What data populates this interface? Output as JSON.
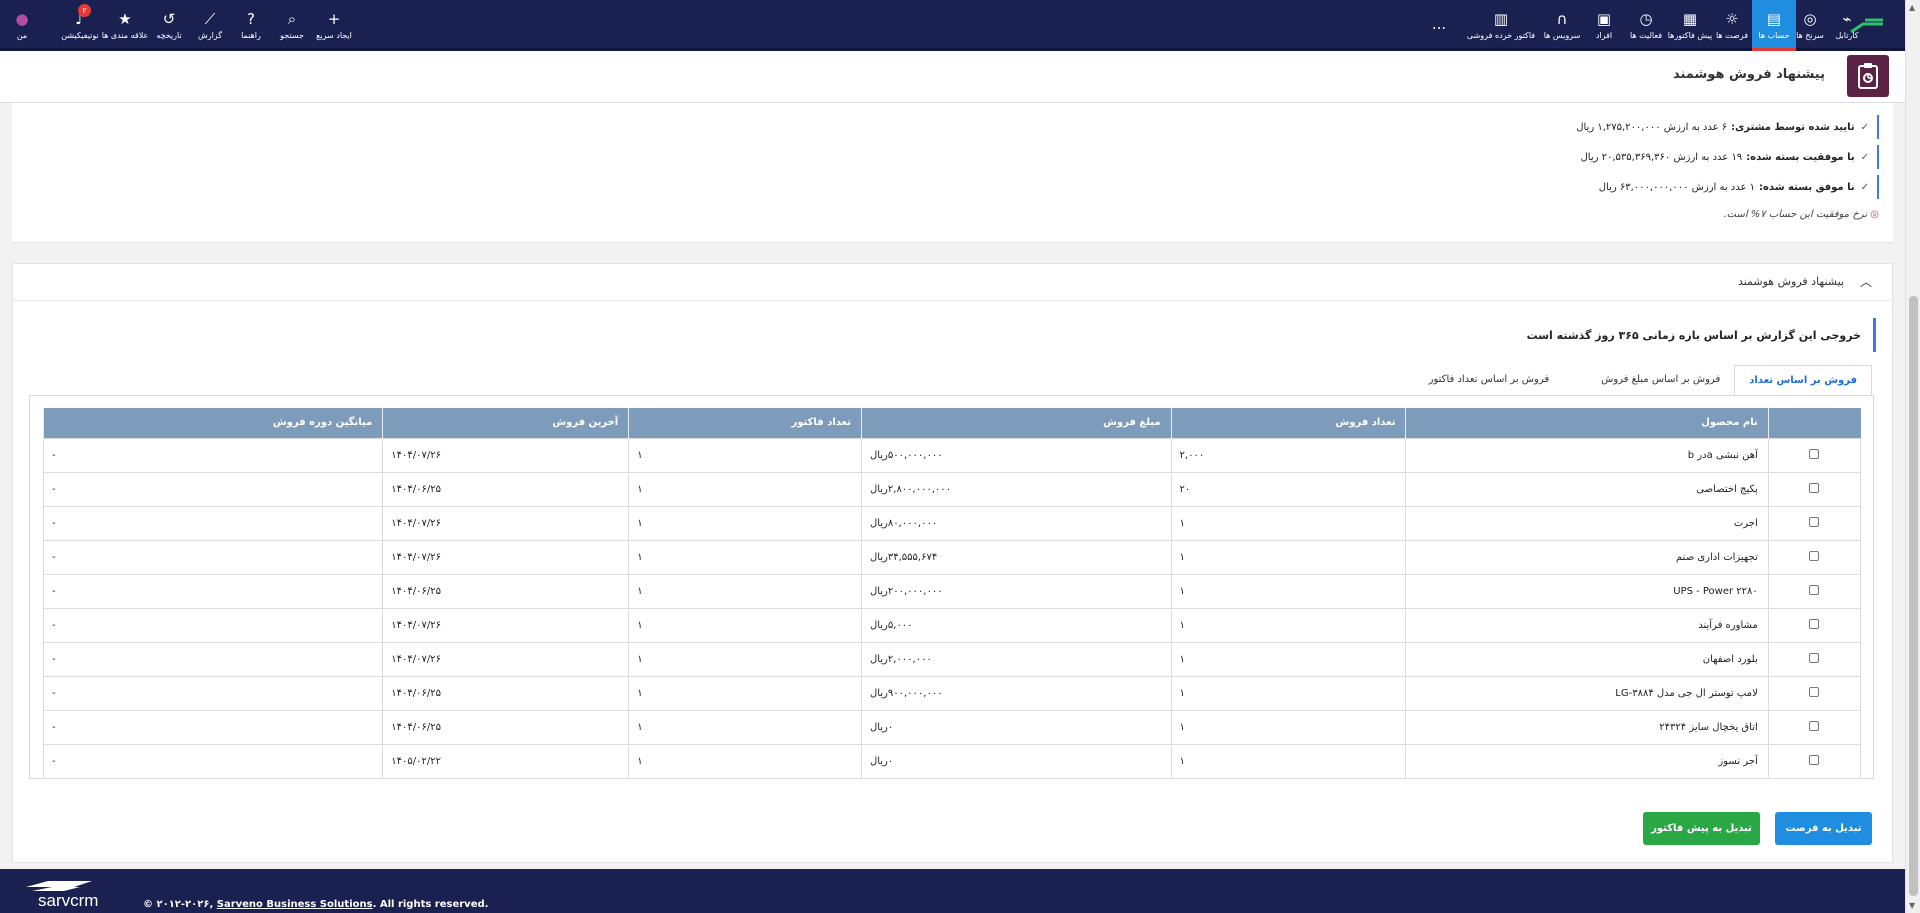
{
  "nav": {
    "right_items": [
      {
        "label": "کارتابل",
        "icon": "kartabl-logo-icon"
      },
      {
        "label": "سرنخ ها",
        "icon": "target-icon"
      },
      {
        "label": "حساب ها",
        "icon": "account-book-icon",
        "active": true
      },
      {
        "label": "فرصت ها",
        "icon": "lightbulb-icon"
      },
      {
        "label": "پیش فاکتورها",
        "icon": "invoice-icon"
      },
      {
        "label": "فعالیت ها",
        "icon": "clock-icon"
      },
      {
        "label": "افراد",
        "icon": "id-card-icon"
      },
      {
        "label": "سرویس ها",
        "icon": "headset-icon"
      },
      {
        "label": "فاکتور خرده فروشی",
        "icon": "receipt-icon"
      }
    ],
    "more_label": "...",
    "left_items": [
      {
        "label": "ایجاد سریع",
        "icon": "plus-icon"
      },
      {
        "label": "جستجو",
        "icon": "search-icon"
      },
      {
        "label": "راهنما",
        "icon": "help-icon"
      },
      {
        "label": "گزارش",
        "icon": "chart-icon"
      },
      {
        "label": "تاریخچه",
        "icon": "history-icon"
      },
      {
        "label": "علاقه مندی ها",
        "icon": "star-icon"
      },
      {
        "label": "نوتیفیکیشن",
        "icon": "bell-icon",
        "badge": "۲"
      },
      {
        "label": "من",
        "icon": "user-avatar-icon"
      }
    ],
    "colors": {
      "bar": "#1a2150",
      "active": "#1f8de0",
      "badge": "#e53935"
    }
  },
  "page": {
    "title": "پیشنهاد فروش هوشمند"
  },
  "stats": {
    "lines": [
      {
        "label": "تایید شده توسط مشتری:",
        "text": "۶ عدد به ارزش ۱,۲۷۵,۲۰۰,۰۰۰ ریال"
      },
      {
        "label": "با موفقیت بسته شده:",
        "text": "۱۹ عدد به ارزش ۲۰,۵۳۵,۳۶۹,۳۶۰ ریال"
      },
      {
        "label": "نا موفق بسته شده:",
        "text": "۱ عدد به ارزش ۶۳,۰۰۰,۰۰۰,۰۰۰ ریال"
      }
    ],
    "check": "✓",
    "note": "نرخ موفقیت این حساب ۷% است."
  },
  "smart": {
    "section_title": "پیشنهاد فروش هوشمند",
    "info": "خروجی این گزارش بر اساس بازه زمانی ۳۶۵ روز گذشته است",
    "tabs": [
      "فروش بر اساس تعداد",
      "فروش بر اساس مبلغ فروش",
      "فروش بر اساس تعداد فاکتور"
    ],
    "columns": [
      "نام محصول",
      "تعداد فروش",
      "مبلغ فروش",
      "تعداد فاکتور",
      "آخرین فروش",
      "میانگین دوره فروش"
    ],
    "rows": [
      [
        "آهن نبشی aدر b",
        "۲,۰۰۰",
        "۵۰۰,۰۰۰,۰۰۰ریال",
        "۱",
        "۱۴۰۴/۰۷/۲۶",
        "-"
      ],
      [
        "پکیج اختصاصی",
        "۲۰",
        "۲,۸۰۰,۰۰۰,۰۰۰ریال",
        "۱",
        "۱۴۰۴/۰۶/۲۵",
        "-"
      ],
      [
        "اجرت",
        "۱",
        "۸۰,۰۰۰,۰۰۰ریال",
        "۱",
        "۱۴۰۴/۰۷/۲۶",
        "-"
      ],
      [
        "تجهیزات اداری صنم",
        "۱",
        "۳۴,۵۵۵,۶۷۴ریال",
        "۱",
        "۱۴۰۴/۰۷/۲۶",
        "-"
      ],
      [
        "UPS - Power ۲۲۸۰",
        "۱",
        "۲۰۰,۰۰۰,۰۰۰ریال",
        "۱",
        "۱۴۰۴/۰۶/۲۵",
        "-"
      ],
      [
        "مشاوره فرآیند",
        "۱",
        "۵,۰۰۰ریال",
        "۱",
        "۱۴۰۴/۰۷/۲۶",
        "-"
      ],
      [
        "بلورد اصفهان",
        "۱",
        "۲,۰۰۰,۰۰۰ریال",
        "۱",
        "۱۴۰۴/۰۷/۲۶",
        "-"
      ],
      [
        "لامپ توستر ال جی مدل LG-۳۸۸۴",
        "۱",
        "۹۰۰,۰۰۰,۰۰۰ریال",
        "۱",
        "۱۴۰۴/۰۶/۲۵",
        "-"
      ],
      [
        "اتاق یخچال سایز ۲۴۳۲۴",
        "۱",
        "۰ریال",
        "۱",
        "۱۴۰۴/۰۶/۲۵",
        "-"
      ],
      [
        "آجر نسوز",
        "۱",
        "۰ریال",
        "۱",
        "۱۴۰۵/۰۲/۲۲",
        "-"
      ]
    ],
    "buttons": {
      "to_opportunity": "تبدیل به فرصت",
      "to_proforma": "تبدیل به پیش فاکتور"
    },
    "colors": {
      "header": "#7d9bbb",
      "blue_button": "#1f8de0",
      "green_button": "#2ba846",
      "info_border": "#3d7be0"
    }
  },
  "footer": {
    "brand": "sarvcrm",
    "copy_prefix": "© ۲۰۱۲-۲۰۲۶, ",
    "company": "Sarveno Business Solutions",
    "copy_suffix": ". All rights reserved."
  }
}
